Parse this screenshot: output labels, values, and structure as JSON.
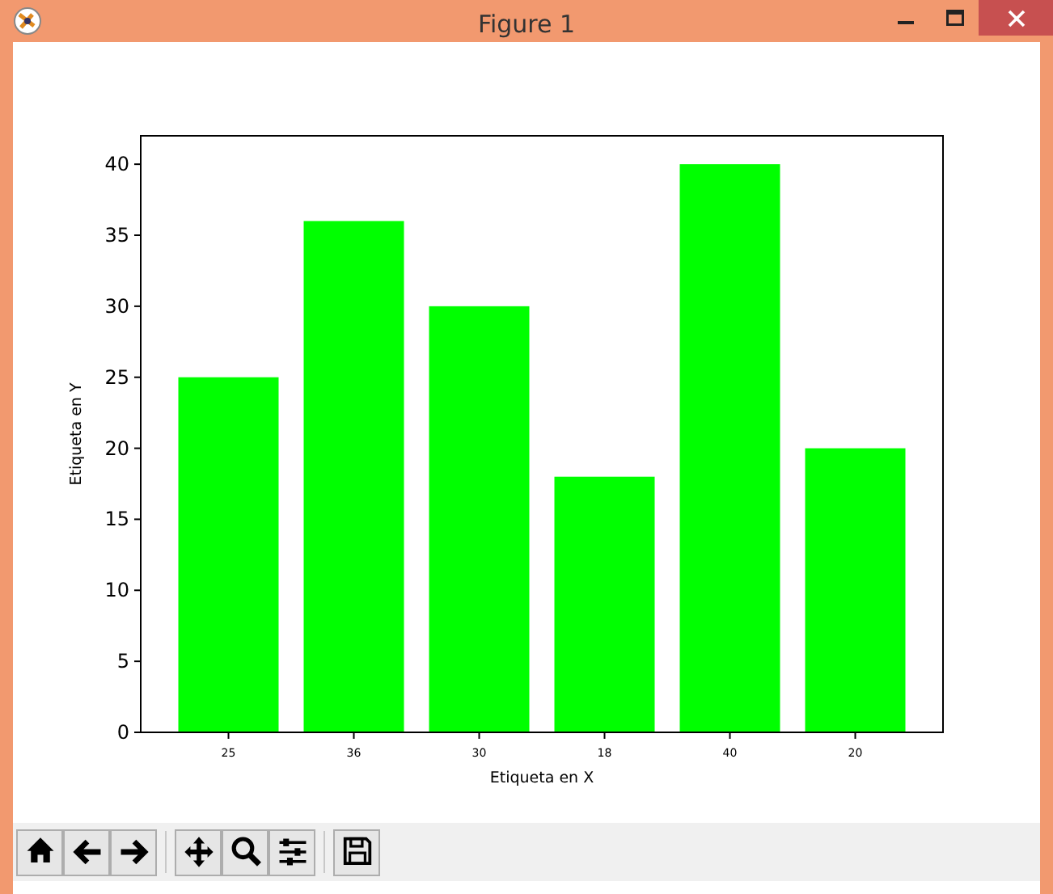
{
  "window": {
    "title": "Figure 1"
  },
  "chart_data": {
    "type": "bar",
    "xlabel": "Etiqueta en X",
    "ylabel": "Etiqueta en Y",
    "categories": [
      "25",
      "36",
      "30",
      "18",
      "40",
      "20"
    ],
    "series": [
      {
        "color": "#00ff00",
        "values": [
          25,
          36,
          30,
          18,
          40,
          20
        ]
      }
    ],
    "ylim": [
      0,
      42
    ],
    "yticks": [
      0,
      5,
      10,
      15,
      20,
      25,
      30,
      35,
      40
    ]
  },
  "toolbar": [
    {
      "kind": "home"
    },
    {
      "kind": "back"
    },
    {
      "kind": "forward"
    },
    {
      "kind": "separator"
    },
    {
      "kind": "pan"
    },
    {
      "kind": "zoom"
    },
    {
      "kind": "configure"
    },
    {
      "kind": "separator"
    },
    {
      "kind": "save"
    }
  ]
}
